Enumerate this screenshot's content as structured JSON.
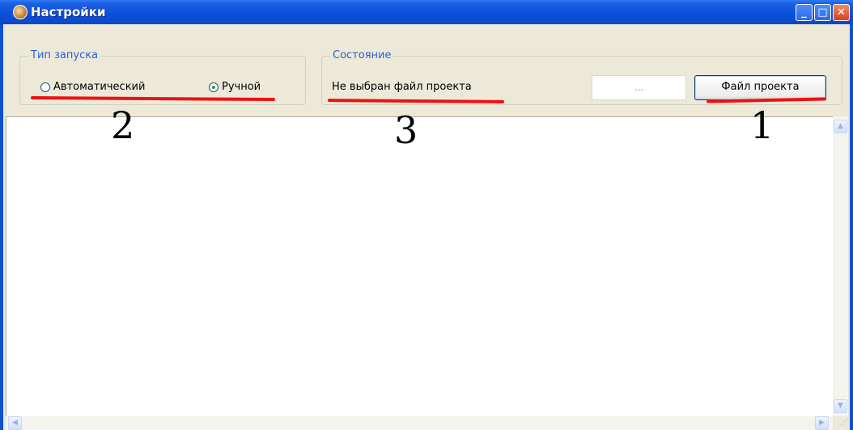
{
  "window": {
    "title": "Настройки"
  },
  "titlebar_buttons": {
    "minimize": "_",
    "maximize": "□",
    "close": "✕"
  },
  "launch_group": {
    "label": "Тип запуска",
    "options": [
      {
        "label": "Автоматический",
        "selected": false
      },
      {
        "label": "Ручной",
        "selected": true
      }
    ]
  },
  "state_group": {
    "label": "Состояние",
    "status": "Не выбран файл проекта",
    "path_placeholder": "...",
    "project_file_button": "Файл проекта"
  },
  "annotations": [
    "2",
    "3",
    "1"
  ],
  "colors": {
    "accent": "#0a53d6",
    "annotation_underline": "#ee1111",
    "group_label": "#2a5fd0"
  },
  "icons": {
    "app": "app-icon",
    "scroll_up": "scroll-up-arrow-icon",
    "scroll_down": "scroll-down-arrow-icon",
    "scroll_left": "scroll-left-arrow-icon",
    "scroll_right": "scroll-right-arrow-icon",
    "resize": "resize-grip-icon"
  }
}
